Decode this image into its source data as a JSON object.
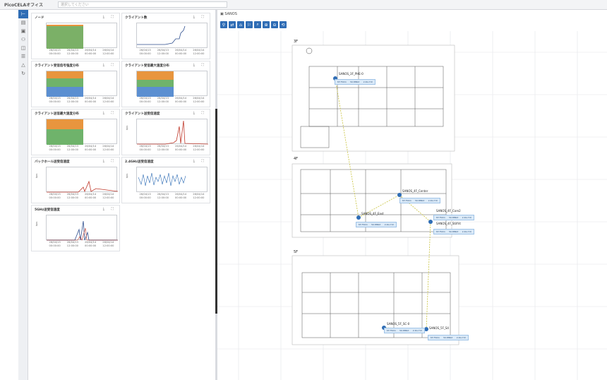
{
  "header": {
    "app_title": "PicoCELAオフィス",
    "search_placeholder": "選択してください"
  },
  "sidebar": {
    "icons": [
      "tree-icon",
      "document-icon",
      "folder-icon",
      "network-icon",
      "chat-icon",
      "list-icon",
      "warning-icon",
      "history-icon"
    ]
  },
  "cards": [
    {
      "title": "ノード",
      "ticks": [
        "26/04/13\n00:00:00",
        "26/04/13\n12:00:00",
        "26/04/14\n00:00:00",
        "26/04/14\n12:00:00"
      ]
    },
    {
      "title": "クライアント数",
      "ticks": [
        "26/04/13\n00:00:00",
        "26/04/13\n12:00:00",
        "26/04/14\n00:00:00",
        "26/04/14\n12:00:00"
      ]
    },
    {
      "title": "クライアント受信信号強度分布",
      "ticks": [
        "26/04/13\n00:00:00",
        "26/04/13\n12:00:00",
        "26/04/14\n00:00:00",
        "26/04/14\n12:00:00"
      ]
    },
    {
      "title": "クライアント受信最大速度分布",
      "ticks": [
        "26/04/13\n00:00:00",
        "26/04/13\n12:00:00",
        "26/04/14\n00:00:00",
        "26/04/14\n12:00:00"
      ]
    },
    {
      "title": "クライアント送信最大速度分布",
      "ticks": [
        "26/04/13\n00:00:00",
        "26/04/13\n12:00:00",
        "26/04/14\n00:00:00",
        "26/04/14\n12:00:00"
      ]
    },
    {
      "title": "クライアント送受信速度",
      "ylabel": "bps",
      "ticks": [
        "26/04/13\n00:00:00",
        "26/04/13\n12:00:00",
        "26/04/14\n00:00:00",
        "26/04/14\n12:00:00"
      ]
    },
    {
      "title": "バックホール送受信速度",
      "ylabel": "bps",
      "ticks": [
        "26/04/13\n00:00:00",
        "26/04/13\n12:00:00",
        "26/04/14\n00:00:00",
        "26/04/14\n12:00:00"
      ]
    },
    {
      "title": "2.4GHz送受信速度",
      "ylabel": "bps",
      "ticks": [
        "26/04/13\n00:00:00",
        "26/04/13\n12:00:00",
        "26/04/14\n00:00:00",
        "26/04/14\n12:00:00"
      ]
    },
    {
      "title": "5GHz送受信速度",
      "ylabel": "bps",
      "ticks": [
        "26/04/13\n00:00:00",
        "26/04/13\n12:00:00",
        "26/04/14\n00:00:00",
        "26/04/14\n12:00:00"
      ]
    }
  ],
  "card_icon_glyphs": "⤓ ⛶",
  "map": {
    "tab_label": "SANOS",
    "toolbar": [
      "⚲",
      "⇄",
      "⌂",
      "⚐",
      "⌕",
      "⊕",
      "⊖",
      "⟲"
    ],
    "floors": [
      {
        "label": "3F"
      },
      {
        "label": "4F"
      },
      {
        "label": "5F"
      }
    ],
    "aps": [
      {
        "name": "SANOS_3F_PHE-0",
        "cells": [
          "ST:750m",
          "50.8Mbit",
          "2.4G:7ch"
        ]
      },
      {
        "name": "SANOS_4F_Center",
        "cells": [
          "ST:750m",
          "50.8Mbit",
          "2.4G:7ch"
        ]
      },
      {
        "name": "SANOS_4F_East",
        "cells": [
          "ST:750m",
          "50.8Mbit",
          "2.4G:7ch"
        ]
      },
      {
        "name": "SANOS_4F_Core2",
        "cells": [
          "ST:750m",
          "50.8Mbit",
          "2.4G:7ch"
        ]
      },
      {
        "name": "SANOS_4F_Stilfrit",
        "cells": [
          "ST:750m",
          "50.8Mbit",
          "2.4G:7ch"
        ]
      },
      {
        "name": "SANOS_5F_SC-0",
        "cells": [
          "ST:750m",
          "50.8Mbit",
          "2.4G:7ch"
        ]
      },
      {
        "name": "SANOS_5F_S4",
        "cells": [
          "ST:750m",
          "50.8Mbit",
          "2.4G:7ch"
        ]
      }
    ]
  }
}
